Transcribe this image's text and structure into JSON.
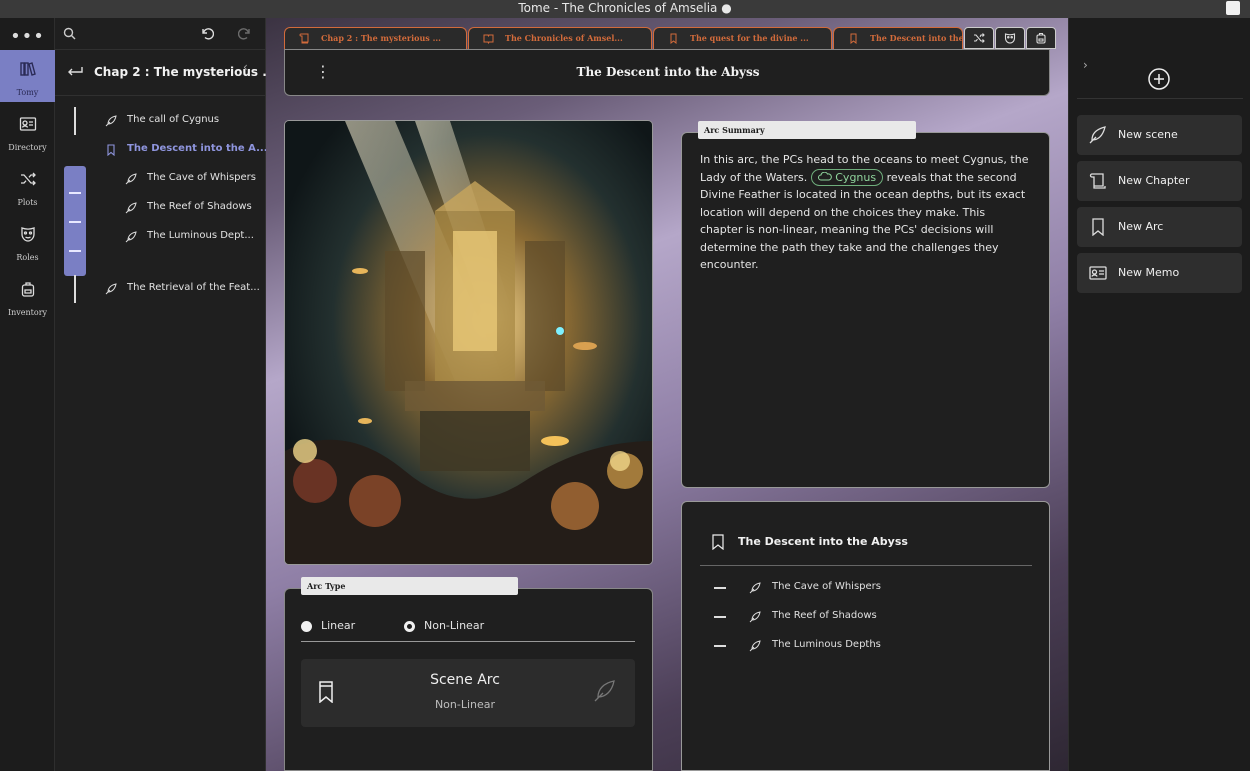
{
  "window": {
    "title": "Tome - The Chronicles of Amselia ●"
  },
  "rail": {
    "more": "•••",
    "items": [
      {
        "label": "Tomy",
        "icon": "books-icon"
      },
      {
        "label": "Directory",
        "icon": "id-card-icon"
      },
      {
        "label": "Plots",
        "icon": "shuffle-icon"
      },
      {
        "label": "Roles",
        "icon": "mask-icon"
      },
      {
        "label": "Inventory",
        "icon": "backpack-icon"
      }
    ]
  },
  "tree": {
    "heading": "Chap 2 : The mysterious ...",
    "collapse": "‹",
    "items": [
      {
        "label": "The call of Cygnus",
        "level": 0
      },
      {
        "label": "The Descent into the A...",
        "level": 0,
        "active": true
      },
      {
        "label": "The Cave of Whispers",
        "level": 1
      },
      {
        "label": "The Reef of Shadows",
        "level": 1
      },
      {
        "label": "The Luminous Dept...",
        "level": 1
      },
      {
        "label": "The Retrieval of the Feat...",
        "level": 0
      }
    ]
  },
  "tabs": [
    {
      "label": "Chap 2 : The mysterious ...",
      "icon": "scroll-icon"
    },
    {
      "label": "The Chronicles of Amsel...",
      "icon": "book-icon"
    },
    {
      "label": "The quest for the divine ...",
      "icon": "bookmark-icon"
    },
    {
      "label": "The Descent into the",
      "icon": "bookmark-icon"
    }
  ],
  "tab_buttons": [
    "shuffle-icon",
    "mask-icon",
    "backpack-icon"
  ],
  "doc": {
    "title": "The Descent into the Abyss",
    "menu": "⋮"
  },
  "arc_type": {
    "label": "Arc Type",
    "options": [
      {
        "label": "Linear",
        "selected": false
      },
      {
        "label": "Non-Linear",
        "selected": true
      }
    ],
    "scene_arc_title": "Scene Arc",
    "scene_arc_value": "Non-Linear"
  },
  "summary": {
    "label": "Arc Summary",
    "before": "In this arc, the PCs head to the oceans to meet Cygnus, the Lady of the Waters.",
    "mention": "Cygnus",
    "after": "reveals that the second Divine Feather is located in the ocean depths, but its exact location will depend on the choices they make. This chapter is non-linear, meaning the PCs' decisions will determine the path they take and the challenges they encounter."
  },
  "outline": {
    "title": "The Descent into the Abyss",
    "items": [
      "The Cave of Whispers",
      "The Reef of Shadows",
      "The Luminous Depths"
    ]
  },
  "right": {
    "chevron": "›",
    "actions": [
      {
        "label": "New scene",
        "icon": "quill-icon"
      },
      {
        "label": "New Chapter",
        "icon": "scroll-icon"
      },
      {
        "label": "New Arc",
        "icon": "bookmark-icon"
      },
      {
        "label": "New Memo",
        "icon": "id-card-icon"
      }
    ]
  },
  "colors": {
    "accent": "#7a7fc4",
    "tab_orange": "#d26b3b",
    "mention_green": "#8fd49c"
  }
}
